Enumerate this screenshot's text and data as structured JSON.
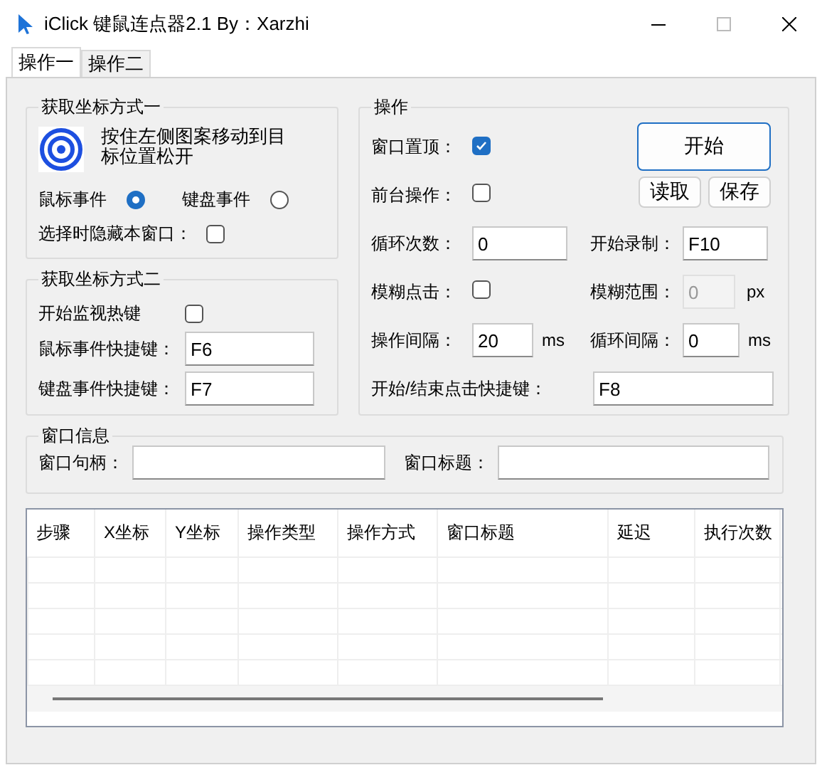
{
  "window": {
    "title": "iClick 键鼠连点器2.1 By：Xarzhi"
  },
  "tabs": [
    {
      "label": "操作一",
      "selected": true
    },
    {
      "label": "操作二",
      "selected": false
    }
  ],
  "coord_method_1": {
    "title": "获取坐标方式一",
    "instruction": "按住左侧图案移动到目标位置松开",
    "radios": [
      {
        "label": "鼠标事件",
        "selected": true
      },
      {
        "label": "键盘事件",
        "selected": false
      }
    ],
    "hide_window": {
      "label": "选择时隐藏本窗口：",
      "checked": false
    }
  },
  "coord_method_2": {
    "title": "获取坐标方式二",
    "monitor_hotkey": {
      "label": "开始监视热键",
      "checked": false
    },
    "fields": [
      {
        "label": "鼠标事件快捷键：",
        "value": "F6"
      },
      {
        "label": "键盘事件快捷键：",
        "value": "F7"
      }
    ]
  },
  "operation": {
    "title": "操作",
    "checks": [
      {
        "label": "窗口置顶：",
        "checked": true
      },
      {
        "label": "前台操作：",
        "checked": false
      }
    ],
    "start_button": "开始",
    "buttons": [
      "读取",
      "保存"
    ],
    "loop_count": {
      "label": "循环次数：",
      "value": "0"
    },
    "record": {
      "label": "开始录制：",
      "value": "F10"
    },
    "fuzzy_click": {
      "label": "模糊点击：",
      "checked": false
    },
    "fuzzy_range": {
      "label": "模糊范围：",
      "value": "0",
      "unit": "px",
      "disabled": true
    },
    "interval": {
      "label": "操作间隔：",
      "value": "20",
      "unit": "ms"
    },
    "loop_interval": {
      "label": "循环间隔：",
      "value": "0",
      "unit": "ms"
    },
    "hotkey": {
      "label": "开始/结束点击快捷键：",
      "value": "F8"
    }
  },
  "window_info": {
    "title": "窗口信息",
    "fields": [
      {
        "label": "窗口句柄："
      },
      {
        "label": "窗口标题："
      }
    ]
  },
  "table": {
    "columns": [
      "步骤",
      "X坐标",
      "Y坐标",
      "操作类型",
      "操作方式",
      "窗口标题",
      "延迟",
      "执行次数"
    ]
  }
}
